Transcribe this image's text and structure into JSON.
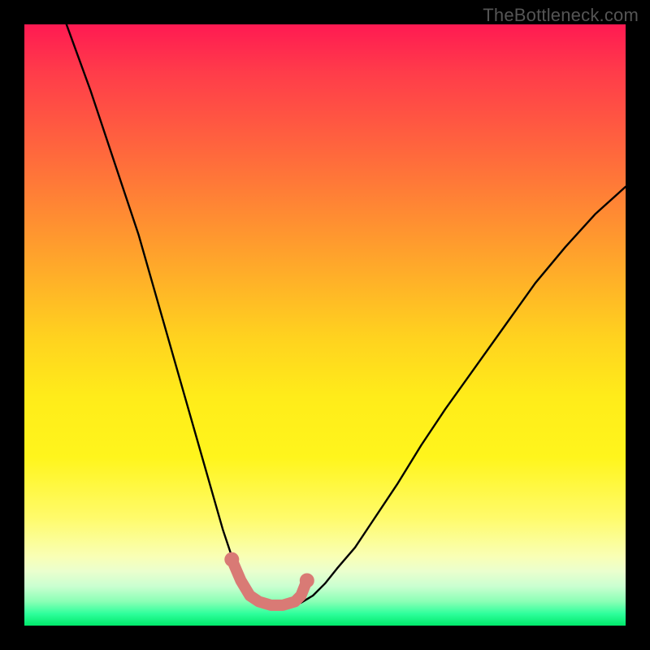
{
  "watermark": "TheBottleneck.com",
  "colors": {
    "curve_stroke": "#000000",
    "marker_stroke": "#d97a75",
    "marker_fill": "#d97a75",
    "frame_bg": "#000000",
    "gradient_top": "#ff1a52",
    "gradient_bottom": "#00e86a"
  },
  "chart_data": {
    "type": "line",
    "title": "",
    "xlabel": "",
    "ylabel": "",
    "xlim": [
      0,
      100
    ],
    "ylim": [
      0,
      100
    ],
    "grid": false,
    "legend": false,
    "note": "Axes are normalized percent coordinates of the plot area since the source image has no tick labels or numeric scale.",
    "series": [
      {
        "name": "curve",
        "x": [
          7,
          9,
          11,
          13,
          15,
          17,
          19,
          21,
          23,
          25,
          27,
          29,
          31,
          33,
          34.5,
          36,
          37,
          38,
          40,
          42,
          44,
          46,
          48,
          50,
          52,
          55,
          58,
          62,
          66,
          70,
          75,
          80,
          85,
          90,
          95,
          100
        ],
        "y": [
          100,
          94.5,
          89,
          83,
          77,
          71,
          65,
          58,
          51,
          44,
          37,
          30,
          23,
          16,
          11.5,
          8,
          6,
          4.5,
          3.5,
          3.2,
          3.3,
          3.8,
          5,
          7,
          9.5,
          13,
          17.5,
          23.5,
          30,
          36,
          43,
          50,
          57,
          63,
          68.5,
          73
        ]
      }
    ],
    "trough_markers": {
      "name": "bottleneck-trough",
      "x": [
        34.5,
        36,
        37.5,
        39,
        41,
        43,
        45,
        46,
        47
      ],
      "y": [
        11,
        7.5,
        5,
        4,
        3.4,
        3.4,
        4,
        5,
        7.5
      ]
    }
  }
}
